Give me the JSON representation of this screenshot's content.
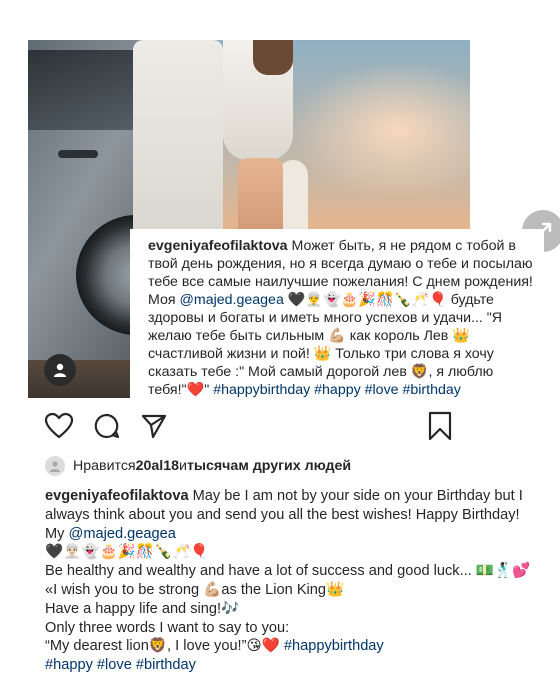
{
  "overlay": {
    "username": "evgeniyafeofilaktova",
    "text1": " Может быть, я не рядом с тобой в твой день рождения, но я всегда думаю о тебе и посылаю тебе все самые наилучшие пожелания! С днем рождения! Моя ",
    "mention": "@majed.geagea",
    "text2": " 🖤👳‍♂️👻🎂🎉🎊🍾🥂🎈 будьте здоровы и богаты и иметь много успехов и удачи... \"Я желаю тебе быть сильным 💪🏼 как король Лев 👑 счастливой жизни и пой! 👑 Только три слова я хочу сказать тебе :\" Мой самый дорогой лев 🦁, я люблю тебя!\"❤️\" ",
    "hashtags": "#happybirthday #happy #love #birthday"
  },
  "likes": {
    "prefix": "Нравится ",
    "user": "20al18",
    "middle": " и ",
    "others": "тысячам других людей"
  },
  "caption": {
    "username": "evgeniyafeofilaktova",
    "line1": " May be I am not by your side on your Birthday but I always think about you and send you all the best wishes! Happy Birthday! My ",
    "mention": "@majed.geagea",
    "emojis": "🖤👳🏻‍♂️👻🎂🎉🎊🍾🥂🎈",
    "line2": "Be healthy and wealthy and have a lot of success and good luck... 💵🕺🏿💕",
    "line3": "«I wish you to be strong 💪🏼as the Lion King👑",
    "line4": "Have a happy life and sing!🎶",
    "line5": "Only three words I want to say to you:",
    "line6": "“My dearest lion🦁, I love you!”😘❤️ ",
    "hashtag_first": "#happybirthday",
    "hashtags_rest": "#happy #love #birthday"
  },
  "icons": [
    "heart-icon",
    "comment-icon",
    "share-icon",
    "bookmark-icon",
    "user-tag-icon",
    "expand-icon",
    "avatar-icon"
  ],
  "colors": {
    "link": "#003569",
    "text": "#262626"
  }
}
